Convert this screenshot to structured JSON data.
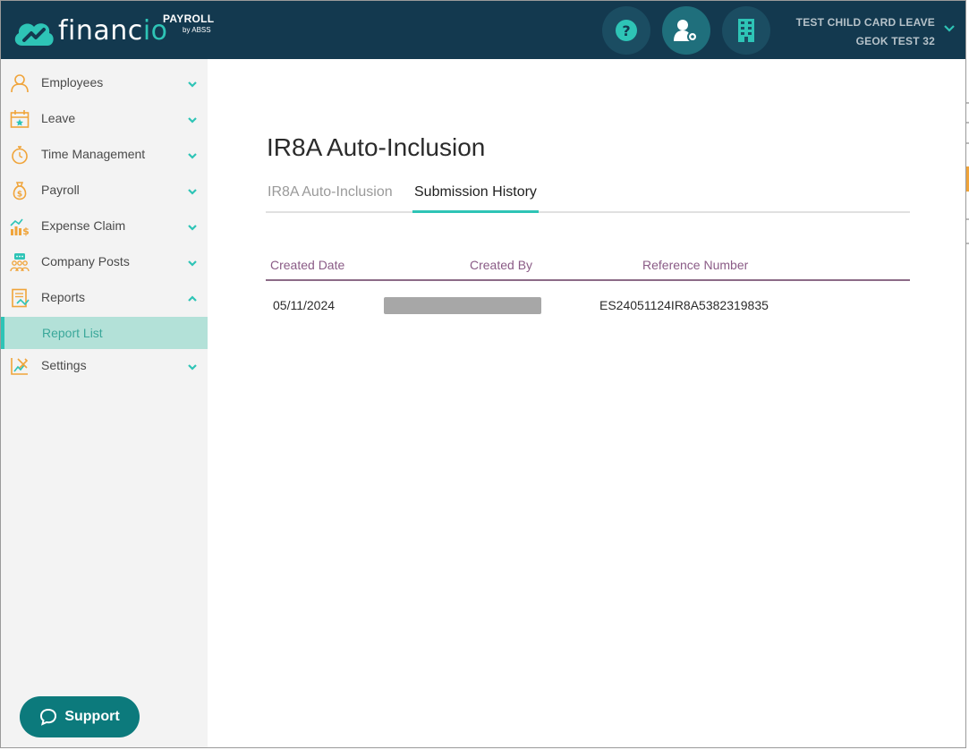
{
  "header": {
    "logo_text": "financ",
    "logo_text_accent": "io",
    "logo_product": "PAYROLL",
    "logo_by": "by ABSS",
    "user_line1": "TEST CHILD CARD LEAVE",
    "user_line2": "GEOK TEST 32"
  },
  "sidebar": {
    "items": [
      {
        "label": "Employees",
        "icon": "person-icon"
      },
      {
        "label": "Leave",
        "icon": "calendar-icon"
      },
      {
        "label": "Time Management",
        "icon": "stopwatch-icon"
      },
      {
        "label": "Payroll",
        "icon": "money-bag-icon"
      },
      {
        "label": "Expense Claim",
        "icon": "expense-chart-icon"
      },
      {
        "label": "Company Posts",
        "icon": "people-chat-icon"
      },
      {
        "label": "Reports",
        "icon": "report-icon"
      },
      {
        "label": "Settings",
        "icon": "settings-tools-icon"
      }
    ],
    "sub_item": "Report List",
    "support_label": "Support"
  },
  "main": {
    "title": "IR8A Auto-Inclusion",
    "tabs": [
      "IR8A Auto-Inclusion",
      "Submission History"
    ],
    "active_tab": "Submission History",
    "table": {
      "columns": [
        "Created Date",
        "Created By",
        "Reference Number"
      ],
      "rows": [
        {
          "created_date": "05/11/2024",
          "created_by": "",
          "reference_number": "ES24051124IR8A5382319835"
        }
      ]
    }
  },
  "colors": {
    "header_bg": "#13394f",
    "accent": "#2ec4b6",
    "sidebar_bg": "#f3f3f3",
    "column_header": "#8a5b86",
    "support_bg": "#0c7a7c"
  }
}
